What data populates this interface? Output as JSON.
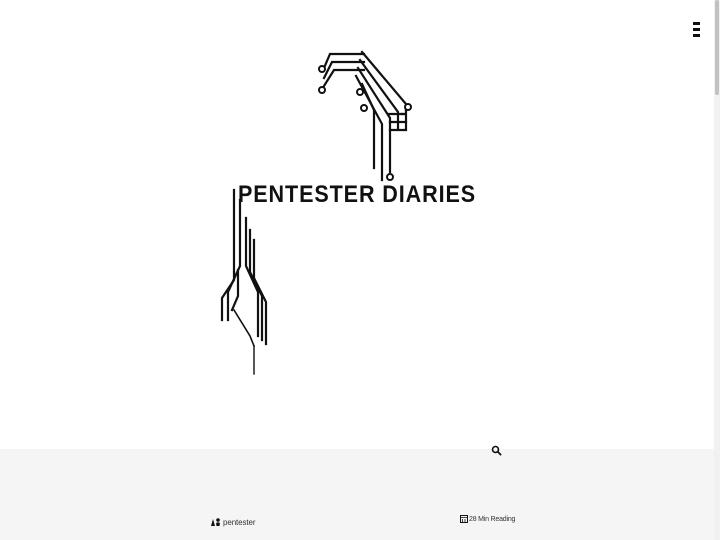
{
  "site": {
    "logo_text": "PENTESTER DIARIES"
  },
  "header": {
    "menu_icon": "hamburger-menu-icon",
    "search_icon": "search-icon"
  },
  "post_meta": {
    "author_icon": "user-icon",
    "author": "pentester",
    "reading_icon": "calendar-icon",
    "reading_time": "28 Min Reading"
  },
  "colors": {
    "background": "#ffffff",
    "section_background": "#f5f5f5",
    "foreground": "#111111"
  }
}
